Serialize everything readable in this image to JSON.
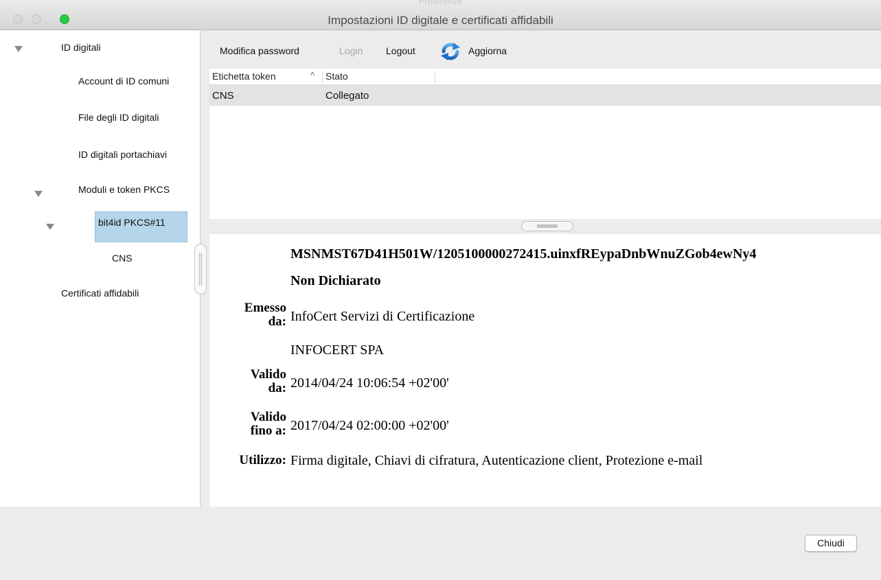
{
  "window": {
    "ghost_title": "Preferenze",
    "title": "Impostazioni ID digitale e certificati affidabili"
  },
  "sidebar": {
    "items": [
      {
        "label": "ID digitali",
        "expanded": true
      },
      {
        "label": "Account di ID comuni"
      },
      {
        "label": "File degli ID digitali"
      },
      {
        "label": "ID digitali portachiavi"
      },
      {
        "label": "Moduli e token PKCS",
        "expanded": true
      },
      {
        "label": "bit4id PKCS#11",
        "expanded": true,
        "selected": true
      },
      {
        "label": "CNS"
      },
      {
        "label": "Certificati affidabili"
      }
    ]
  },
  "toolbar": {
    "change_password": "Modifica password",
    "login": "Login",
    "logout": "Logout",
    "refresh": "Aggiorna",
    "refresh_icon": "refresh-icon"
  },
  "token_table": {
    "columns": [
      "Etichetta token",
      "Stato"
    ],
    "sort_indicator": "^",
    "rows": [
      {
        "label": "CNS",
        "status": "Collegato"
      }
    ]
  },
  "certificate": {
    "name": "MSNMST67D41H501W/1205100000272415.uinxfREypaDnbWnuZGob4ewNy4",
    "subtitle": "Non Dichiarato",
    "issued_by_label": "Emesso da:",
    "issued_by_label_l1": "Emesso",
    "issued_by_label_l2": "da:",
    "issuer_line1": "InfoCert Servizi di Certificazione",
    "issuer_line2": "INFOCERT SPA",
    "valid_from_label_l1": "Valido",
    "valid_from_label_l2": "da:",
    "valid_from": "2014/04/24 10:06:54 +02'00'",
    "valid_to_label_l1": "Valido",
    "valid_to_label_l2": "fino a:",
    "valid_to": "2017/04/24 02:00:00 +02'00'",
    "usage_label": "Utilizzo:",
    "usage": "Firma digitale, Chiavi di cifratura, Autenticazione client, Protezione e-mail"
  },
  "footer": {
    "close_label": "Chiudi"
  },
  "colors": {
    "selection": "#b4d5ea",
    "row_highlight": "#e3e3e3",
    "refresh_blue": "#1e7fd4",
    "zoom_green": "#28c840"
  }
}
